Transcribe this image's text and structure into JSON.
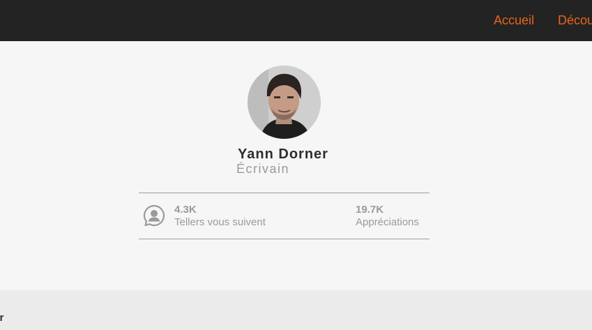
{
  "nav": {
    "items": [
      {
        "label": "Accueil"
      },
      {
        "label": "Découvrir"
      }
    ]
  },
  "profile": {
    "name": "Yann Dorner",
    "role": "Écrivain",
    "stats": {
      "followers": {
        "value": "4.3K",
        "label": "Tellers vous suivent",
        "icon": "user-bubble-icon"
      },
      "likes": {
        "value": "19.7K",
        "label": "Appréciations"
      }
    }
  },
  "footer": {
    "text": "ner"
  },
  "colors": {
    "accent": "#e8641b",
    "topbar": "#232323",
    "background": "#f6f6f6",
    "footer": "#ebebeb",
    "muted": "#9a9a9a",
    "text": "#2e2e2e"
  }
}
